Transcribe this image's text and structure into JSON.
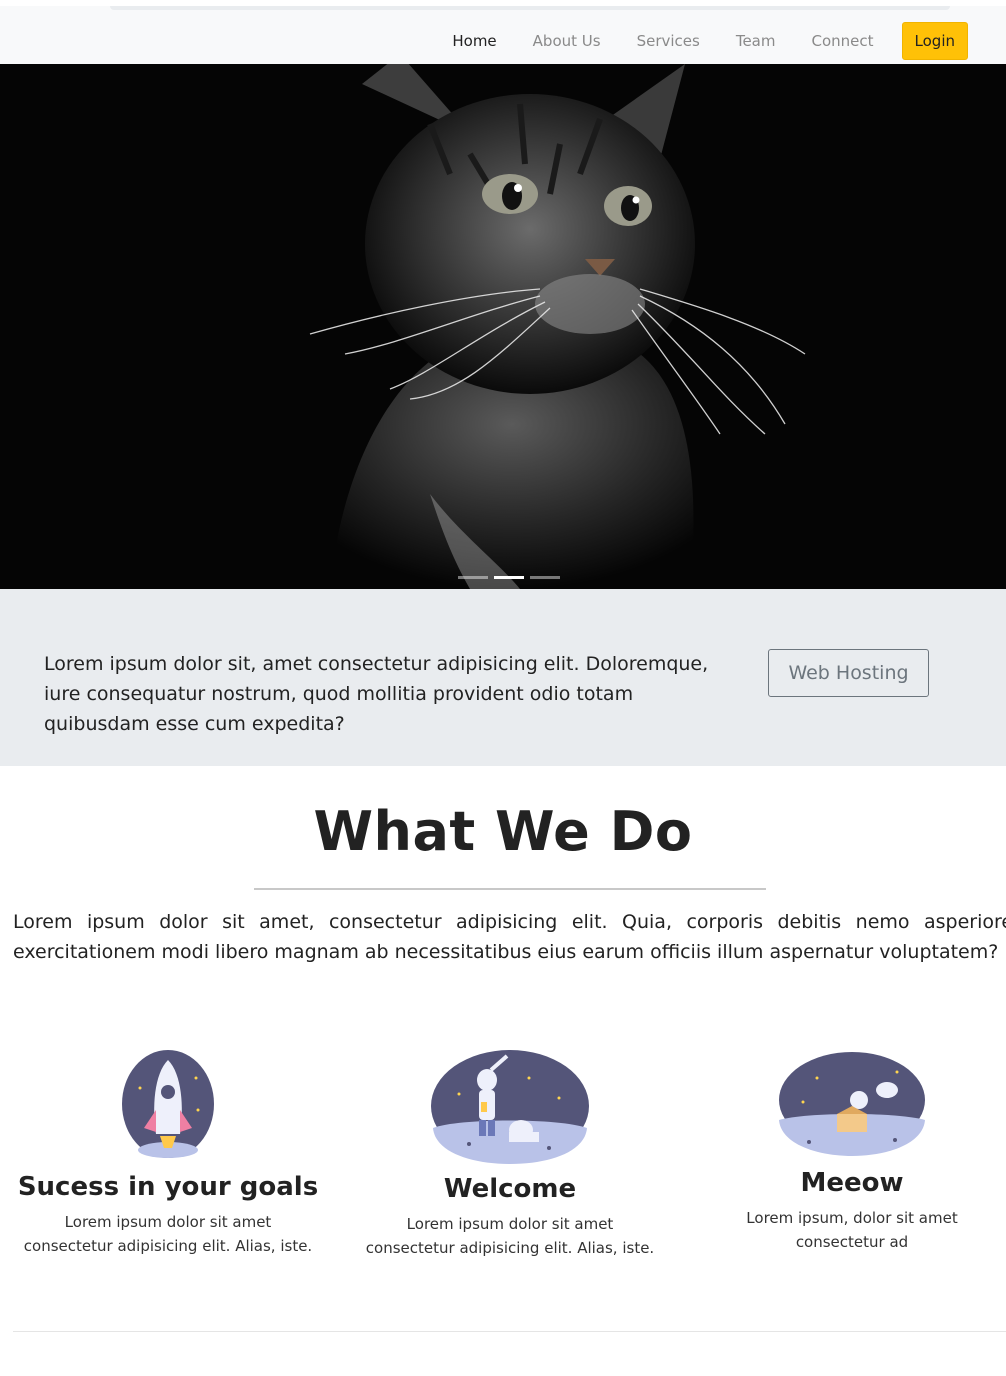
{
  "nav": {
    "items": [
      {
        "label": "Home",
        "active": true
      },
      {
        "label": "About Us",
        "active": false
      },
      {
        "label": "Services",
        "active": false
      },
      {
        "label": "Team",
        "active": false
      },
      {
        "label": "Connect",
        "active": false
      }
    ],
    "login_label": "Login"
  },
  "hero": {
    "slides": 3,
    "active_slide": 2
  },
  "promo": {
    "text": "Lorem ipsum dolor sit, amet consectetur adipisicing elit. Doloremque, iure consequatur nostrum, quod mollitia provident odio totam quibusdam esse cum expedita?",
    "button_label": "Web Hosting"
  },
  "what_we_do": {
    "title": "What We Do",
    "body": "Lorem ipsum dolor sit amet, consectetur adipisicing elit. Quia, corporis debitis nemo asperiores exercitationem modi libero magnam ab necessitatibus eius earum officiis illum aspernatur voluptatem?"
  },
  "cards": [
    {
      "icon": "rocket-illustration-icon",
      "title": "Sucess in your goals",
      "text_line1": "Lorem ipsum dolor sit amet",
      "text_line2": "consectetur adipisicing elit. Alias, iste."
    },
    {
      "icon": "astronaut-illustration-icon",
      "title": "Welcome",
      "text_line1": "Lorem ipsum dolor sit amet",
      "text_line2": "consectetur adipisicing elit. Alias, iste."
    },
    {
      "icon": "space-cat-illustration-icon",
      "title": "Meeow",
      "text_line1": "Lorem ipsum, dolor sit amet",
      "text_line2": "consectetur ad"
    }
  ],
  "colors": {
    "accent": "#ffc107",
    "promo_bg": "#e9ecef",
    "illustration_purple": "#545579",
    "illustration_ground": "#b9c2e8"
  }
}
